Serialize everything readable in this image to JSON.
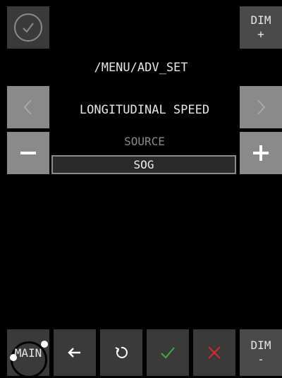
{
  "header": {
    "menu_path": "/MENU/ADV_SET"
  },
  "dim_up": {
    "line1": "DIM",
    "line2": "+"
  },
  "dim_down": {
    "line1": "DIM",
    "line2": "-"
  },
  "parameter": {
    "title": "LONGITUDINAL SPEED",
    "sub_label": "SOURCE",
    "value": "SOG"
  },
  "navigation": {
    "prev_icon": "chevron-left-icon",
    "next_icon": "chevron-right-icon"
  },
  "adjust": {
    "minus_icon": "minus-icon",
    "plus_icon": "plus-icon"
  },
  "bottom_bar": {
    "main_label": "MAIN",
    "icons": [
      "back-arrow-icon",
      "reset-icon",
      "confirm-check-icon",
      "cancel-x-icon"
    ]
  },
  "colors": {
    "background": "#000000",
    "button_dark": "#3a3a3a",
    "button_light": "#8a8a8a",
    "confirm_green": "#3fae3f",
    "cancel_red": "#d62a2a",
    "text": "#e6e6e6",
    "muted_text": "#8a8a8a"
  }
}
